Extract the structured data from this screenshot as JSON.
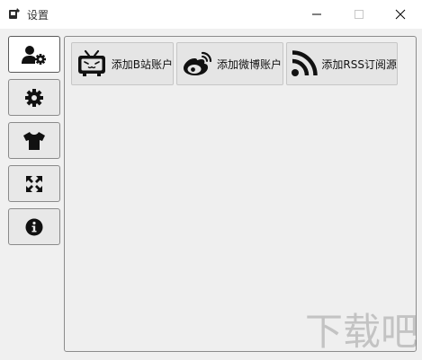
{
  "window": {
    "title": "设置",
    "controls": {
      "minimize_icon": "minimize-icon",
      "maximize_icon": "maximize-icon",
      "close_icon": "close-icon"
    }
  },
  "sidebar": {
    "items": [
      {
        "id": "accounts",
        "icon": "user-gear-icon",
        "active": true
      },
      {
        "id": "settings",
        "icon": "gear-icon",
        "active": false
      },
      {
        "id": "theme",
        "icon": "tshirt-icon",
        "active": false
      },
      {
        "id": "fullscreen",
        "icon": "expand-arrows-icon",
        "active": false
      },
      {
        "id": "about",
        "icon": "info-icon",
        "active": false
      }
    ]
  },
  "main": {
    "buttons": [
      {
        "label": "添加B站账户",
        "icon": "bilibili-tv-icon"
      },
      {
        "label": "添加微博账户",
        "icon": "weibo-icon"
      },
      {
        "label": "添加RSS订阅源",
        "icon": "rss-icon"
      }
    ]
  },
  "watermark": {
    "text": "下载吧"
  },
  "colors": {
    "window_bg": "#f0f0f0",
    "titlebar_bg": "#ffffff",
    "icon": "#111111",
    "panel_border": "#8c8c8c"
  }
}
